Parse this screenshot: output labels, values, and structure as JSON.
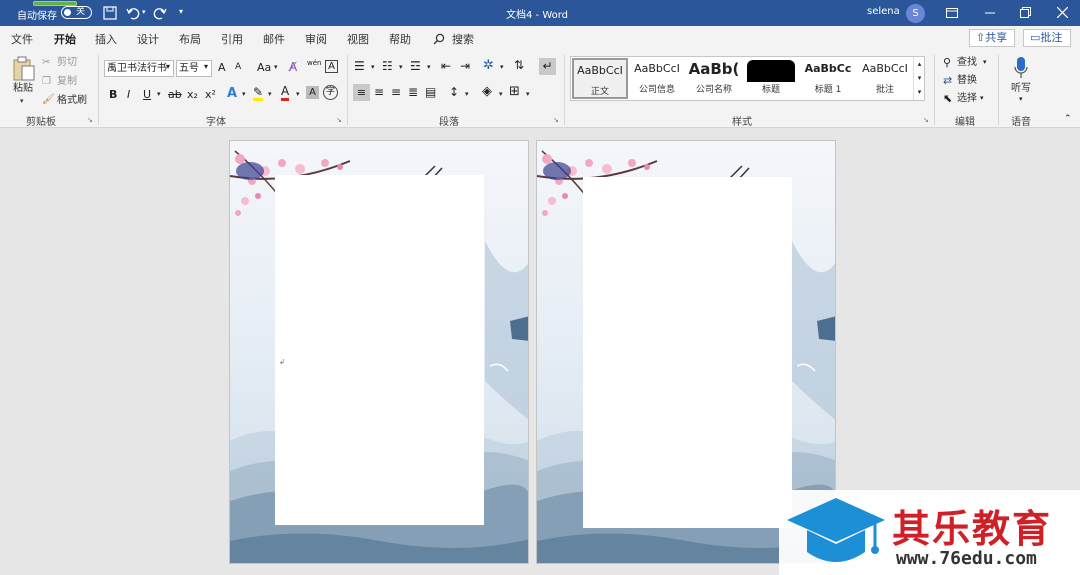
{
  "titlebar": {
    "autosave_label": "自动保存",
    "autosave_state": "关",
    "doc_title": "文档4 - Word",
    "user_name": "selena",
    "user_initial": "S"
  },
  "tabs": [
    "文件",
    "开始",
    "插入",
    "设计",
    "布局",
    "引用",
    "邮件",
    "审阅",
    "视图",
    "帮助",
    "搜索"
  ],
  "active_tab": "开始",
  "top_actions": {
    "share": "共享",
    "comment": "批注"
  },
  "clipboard": {
    "paste": "粘贴",
    "cut": "剪切",
    "copy": "复制",
    "format_painter": "格式刷",
    "group": "剪贴板"
  },
  "font": {
    "name": "禹卫书法行书",
    "size": "五号",
    "group": "字体",
    "bold": "B",
    "italic": "I",
    "underline": "U",
    "strike": "ab",
    "sub": "x₂",
    "sup": "x²",
    "grow": "A",
    "shrink": "A",
    "case": "Aa",
    "effects": "A",
    "highlight": "ab",
    "color": "A",
    "shade": "A",
    "circle": "字",
    "phonetic": "wén"
  },
  "paragraph": {
    "group": "段落"
  },
  "styles": {
    "group": "样式",
    "items": [
      {
        "preview": "AaBbCcI",
        "name": "正文"
      },
      {
        "preview": "AaBbCcI",
        "name": "公司信息"
      },
      {
        "preview": "AaBb(",
        "name": "公司名称"
      },
      {
        "preview": "",
        "name": "标题"
      },
      {
        "preview": "AaBbCc",
        "name": "标题 1"
      },
      {
        "preview": "AaBbCcI",
        "name": "批注"
      }
    ]
  },
  "editing": {
    "find": "查找",
    "replace": "替换",
    "select": "选择",
    "group": "编辑"
  },
  "voice": {
    "dictate": "听写",
    "group": "语音"
  },
  "watermark": {
    "title": "其乐教育",
    "url": "www.76edu.com"
  },
  "colors": {
    "accent": "#2b579a",
    "watermark_red": "#cf1f27",
    "user_avatar": "#6b86d6"
  }
}
